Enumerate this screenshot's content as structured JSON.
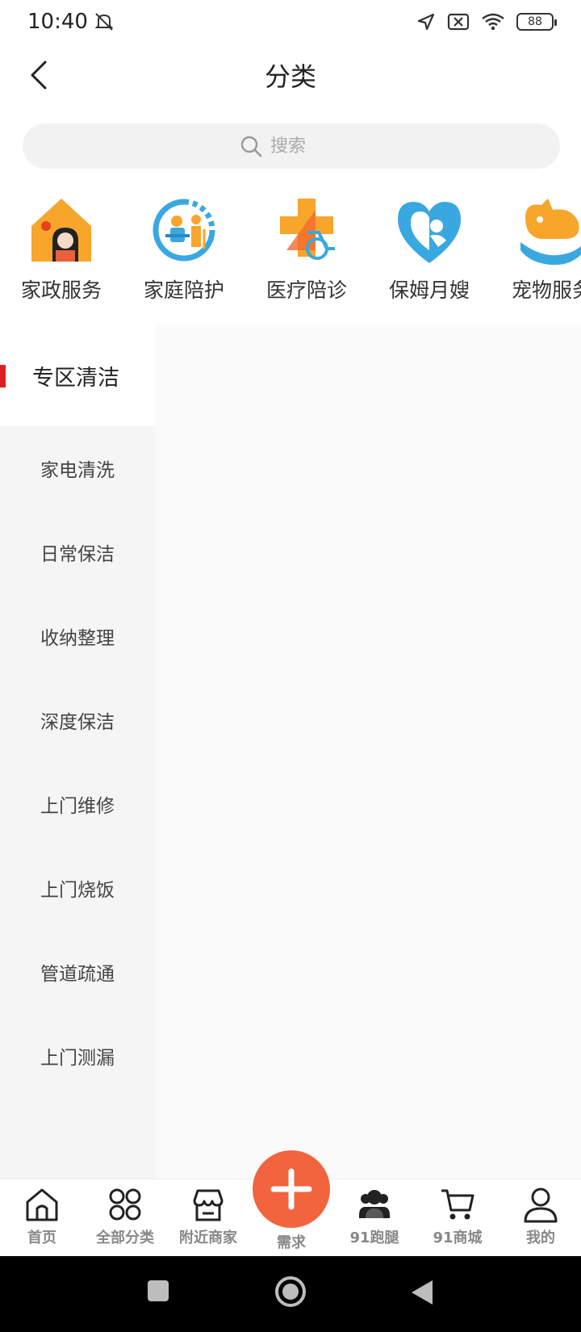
{
  "status_bar": {
    "time": "10:40",
    "battery": "88"
  },
  "header": {
    "title": "分类"
  },
  "search": {
    "placeholder": "搜索"
  },
  "categories": [
    {
      "label": "家政服务",
      "icon": "house-housekeeper-icon"
    },
    {
      "label": "家庭陪护",
      "icon": "elder-care-icon"
    },
    {
      "label": "医疗陪诊",
      "icon": "medical-wheelchair-icon"
    },
    {
      "label": "保姆月嫂",
      "icon": "mother-baby-heart-icon"
    },
    {
      "label": "宠物服务",
      "icon": "pet-hand-icon"
    }
  ],
  "sidebar": {
    "active": "专区清洁",
    "items": [
      "家电清洗",
      "日常保洁",
      "收纳整理",
      "深度保洁",
      "上门维修",
      "上门烧饭",
      "管道疏通",
      "上门测漏"
    ]
  },
  "bottom_nav": {
    "items": [
      {
        "label": "首页",
        "icon": "home-icon"
      },
      {
        "label": "全部分类",
        "icon": "grid-circles-icon"
      },
      {
        "label": "附近商家",
        "icon": "store-icon"
      },
      {
        "label": "需求",
        "icon": "plus-icon"
      },
      {
        "label": "91跑腿",
        "icon": "people-icon"
      },
      {
        "label": "91商城",
        "icon": "cart-icon"
      },
      {
        "label": "我的",
        "icon": "user-icon"
      }
    ]
  },
  "colors": {
    "accent": "#f2643e",
    "active_bar": "#e02020",
    "icon_blue": "#3aa8e0",
    "icon_orange": "#f7a52b"
  }
}
